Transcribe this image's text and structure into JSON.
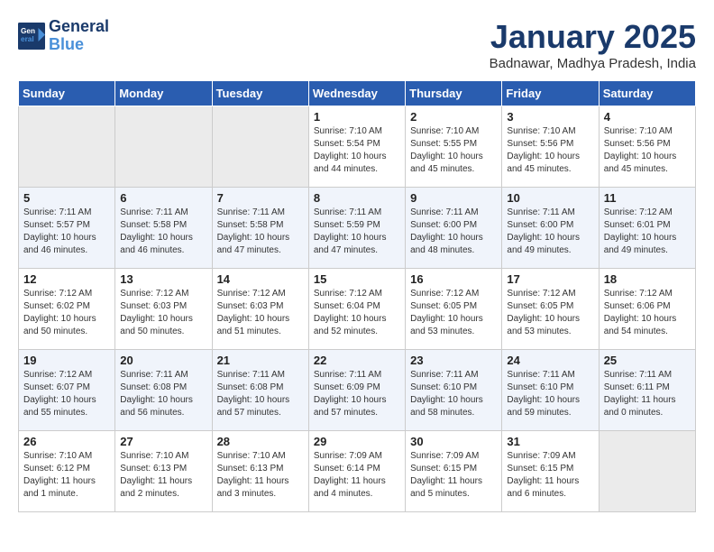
{
  "header": {
    "logo_line1": "General",
    "logo_line2": "Blue",
    "month_title": "January 2025",
    "location": "Badnawar, Madhya Pradesh, India"
  },
  "weekdays": [
    "Sunday",
    "Monday",
    "Tuesday",
    "Wednesday",
    "Thursday",
    "Friday",
    "Saturday"
  ],
  "weeks": [
    [
      {
        "day": "",
        "empty": true
      },
      {
        "day": "",
        "empty": true
      },
      {
        "day": "",
        "empty": true
      },
      {
        "day": "1",
        "sunrise": "7:10 AM",
        "sunset": "5:54 PM",
        "daylight": "10 hours and 44 minutes."
      },
      {
        "day": "2",
        "sunrise": "7:10 AM",
        "sunset": "5:55 PM",
        "daylight": "10 hours and 45 minutes."
      },
      {
        "day": "3",
        "sunrise": "7:10 AM",
        "sunset": "5:56 PM",
        "daylight": "10 hours and 45 minutes."
      },
      {
        "day": "4",
        "sunrise": "7:10 AM",
        "sunset": "5:56 PM",
        "daylight": "10 hours and 45 minutes."
      }
    ],
    [
      {
        "day": "5",
        "sunrise": "7:11 AM",
        "sunset": "5:57 PM",
        "daylight": "10 hours and 46 minutes."
      },
      {
        "day": "6",
        "sunrise": "7:11 AM",
        "sunset": "5:58 PM",
        "daylight": "10 hours and 46 minutes."
      },
      {
        "day": "7",
        "sunrise": "7:11 AM",
        "sunset": "5:58 PM",
        "daylight": "10 hours and 47 minutes."
      },
      {
        "day": "8",
        "sunrise": "7:11 AM",
        "sunset": "5:59 PM",
        "daylight": "10 hours and 47 minutes."
      },
      {
        "day": "9",
        "sunrise": "7:11 AM",
        "sunset": "6:00 PM",
        "daylight": "10 hours and 48 minutes."
      },
      {
        "day": "10",
        "sunrise": "7:11 AM",
        "sunset": "6:00 PM",
        "daylight": "10 hours and 49 minutes."
      },
      {
        "day": "11",
        "sunrise": "7:12 AM",
        "sunset": "6:01 PM",
        "daylight": "10 hours and 49 minutes."
      }
    ],
    [
      {
        "day": "12",
        "sunrise": "7:12 AM",
        "sunset": "6:02 PM",
        "daylight": "10 hours and 50 minutes."
      },
      {
        "day": "13",
        "sunrise": "7:12 AM",
        "sunset": "6:03 PM",
        "daylight": "10 hours and 50 minutes."
      },
      {
        "day": "14",
        "sunrise": "7:12 AM",
        "sunset": "6:03 PM",
        "daylight": "10 hours and 51 minutes."
      },
      {
        "day": "15",
        "sunrise": "7:12 AM",
        "sunset": "6:04 PM",
        "daylight": "10 hours and 52 minutes."
      },
      {
        "day": "16",
        "sunrise": "7:12 AM",
        "sunset": "6:05 PM",
        "daylight": "10 hours and 53 minutes."
      },
      {
        "day": "17",
        "sunrise": "7:12 AM",
        "sunset": "6:05 PM",
        "daylight": "10 hours and 53 minutes."
      },
      {
        "day": "18",
        "sunrise": "7:12 AM",
        "sunset": "6:06 PM",
        "daylight": "10 hours and 54 minutes."
      }
    ],
    [
      {
        "day": "19",
        "sunrise": "7:12 AM",
        "sunset": "6:07 PM",
        "daylight": "10 hours and 55 minutes."
      },
      {
        "day": "20",
        "sunrise": "7:11 AM",
        "sunset": "6:08 PM",
        "daylight": "10 hours and 56 minutes."
      },
      {
        "day": "21",
        "sunrise": "7:11 AM",
        "sunset": "6:08 PM",
        "daylight": "10 hours and 57 minutes."
      },
      {
        "day": "22",
        "sunrise": "7:11 AM",
        "sunset": "6:09 PM",
        "daylight": "10 hours and 57 minutes."
      },
      {
        "day": "23",
        "sunrise": "7:11 AM",
        "sunset": "6:10 PM",
        "daylight": "10 hours and 58 minutes."
      },
      {
        "day": "24",
        "sunrise": "7:11 AM",
        "sunset": "6:10 PM",
        "daylight": "10 hours and 59 minutes."
      },
      {
        "day": "25",
        "sunrise": "7:11 AM",
        "sunset": "6:11 PM",
        "daylight": "11 hours and 0 minutes."
      }
    ],
    [
      {
        "day": "26",
        "sunrise": "7:10 AM",
        "sunset": "6:12 PM",
        "daylight": "11 hours and 1 minute."
      },
      {
        "day": "27",
        "sunrise": "7:10 AM",
        "sunset": "6:13 PM",
        "daylight": "11 hours and 2 minutes."
      },
      {
        "day": "28",
        "sunrise": "7:10 AM",
        "sunset": "6:13 PM",
        "daylight": "11 hours and 3 minutes."
      },
      {
        "day": "29",
        "sunrise": "7:09 AM",
        "sunset": "6:14 PM",
        "daylight": "11 hours and 4 minutes."
      },
      {
        "day": "30",
        "sunrise": "7:09 AM",
        "sunset": "6:15 PM",
        "daylight": "11 hours and 5 minutes."
      },
      {
        "day": "31",
        "sunrise": "7:09 AM",
        "sunset": "6:15 PM",
        "daylight": "11 hours and 6 minutes."
      },
      {
        "day": "",
        "empty": true
      }
    ]
  ],
  "labels": {
    "sunrise": "Sunrise:",
    "sunset": "Sunset:",
    "daylight": "Daylight:"
  }
}
